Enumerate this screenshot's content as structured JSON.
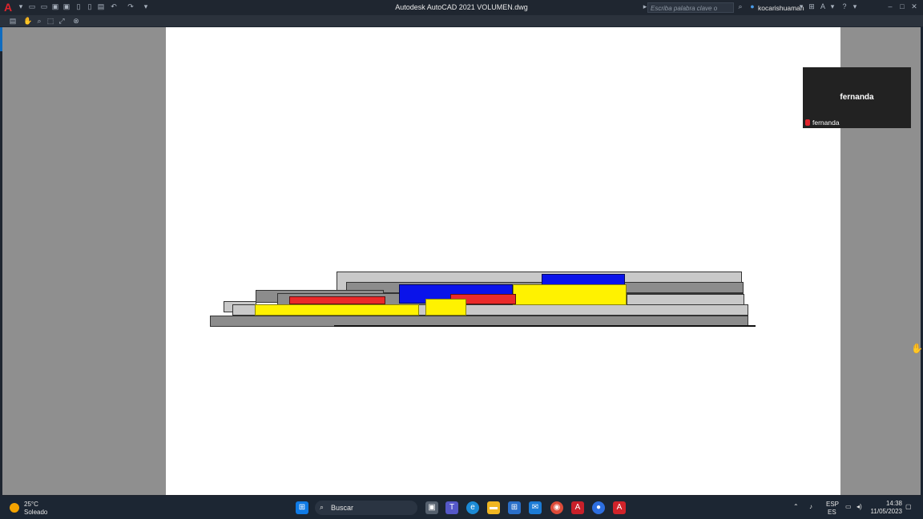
{
  "titlebar": {
    "title": "Autodesk AutoCAD 2021   VOLUMEN.dwg",
    "search_placeholder": "Escriba palabra clave o frase",
    "user": "kocarishuaman",
    "app_icon": "autocad-logo-icon"
  },
  "toolbar": {
    "icons": [
      "print-icon",
      "pan-icon",
      "zoom-icon",
      "zoom-window-icon",
      "zoom-extents-icon",
      "close-preview-icon"
    ]
  },
  "drawing": {
    "colors": {
      "light_gray": "#c9c9c9",
      "dark_gray": "#8c8c8c",
      "red": "#ea2a2a",
      "blue": "#0a13ea",
      "yellow": "#fff200",
      "paper": "#ffffff",
      "workspace": "#8f8f8f"
    }
  },
  "video": {
    "name": "fernanda",
    "label": "fernanda"
  },
  "taskbar": {
    "weather_temp": "25°C",
    "weather_desc": "Soleado",
    "search_label": "Buscar",
    "language": "ESP",
    "language_sub": "ES",
    "time": "14:38",
    "date": "11/05/2023"
  }
}
